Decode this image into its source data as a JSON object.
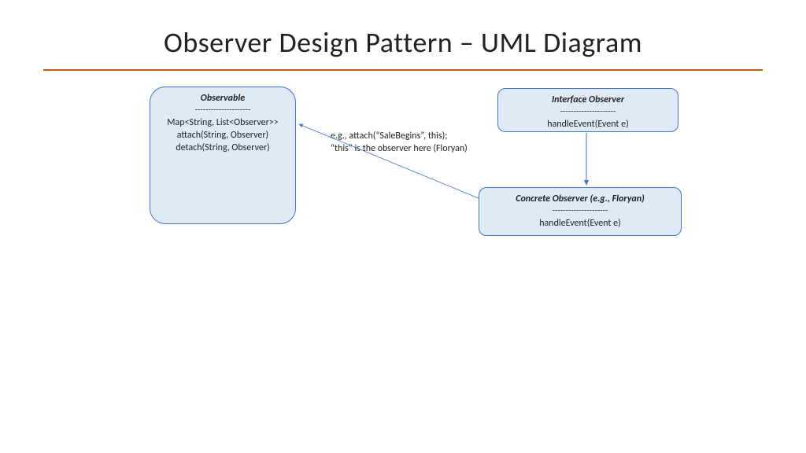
{
  "title": "Observer Design Pattern – UML Diagram",
  "boxes": {
    "observable": {
      "title": "Observable",
      "separator": "---------------------",
      "lines": [
        "Map<String, List<Observer>>",
        "attach(String, Observer)",
        "detach(String, Observer)"
      ]
    },
    "observer_if": {
      "title": "Interface Observer",
      "separator": "---------------------",
      "lines": [
        "handleEvent(Event e)"
      ]
    },
    "concrete": {
      "title": "Concrete Observer (e.g., Floryan)",
      "separator": "---------------------",
      "lines": [
        "handleEvent(Event e)"
      ]
    }
  },
  "annotation": {
    "line1": "e.g., attach(“SaleBegins”, this);",
    "line2": "“this” is the observer here (Floryan)"
  },
  "colors": {
    "accent_line": "#c55a11",
    "box_fill": "#deebf7",
    "box_border": "#4472c4"
  }
}
